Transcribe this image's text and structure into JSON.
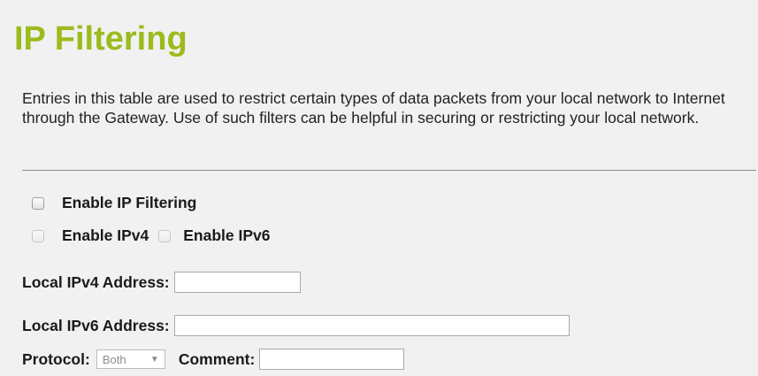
{
  "page": {
    "title": "IP Filtering",
    "description": "Entries in this table are used to restrict certain types of data packets from your local network to Internet through the Gateway. Use of such filters can be helpful in securing or restricting your local network."
  },
  "form": {
    "enable_ip_filtering": {
      "label": "Enable IP Filtering",
      "checked": false
    },
    "enable_ipv4": {
      "label": "Enable IPv4",
      "checked": false,
      "disabled": true
    },
    "enable_ipv6": {
      "label": "Enable IPv6",
      "checked": false,
      "disabled": true
    },
    "local_ipv4": {
      "label": "Local IPv4 Address:",
      "value": ""
    },
    "local_ipv6": {
      "label": "Local IPv6 Address:",
      "value": ""
    },
    "protocol": {
      "label": "Protocol:",
      "selected": "Both",
      "arrow": "▼"
    },
    "comment": {
      "label": "Comment:",
      "value": ""
    }
  },
  "colors": {
    "title": "#9cbb1c",
    "background": "#f1f1f1"
  }
}
